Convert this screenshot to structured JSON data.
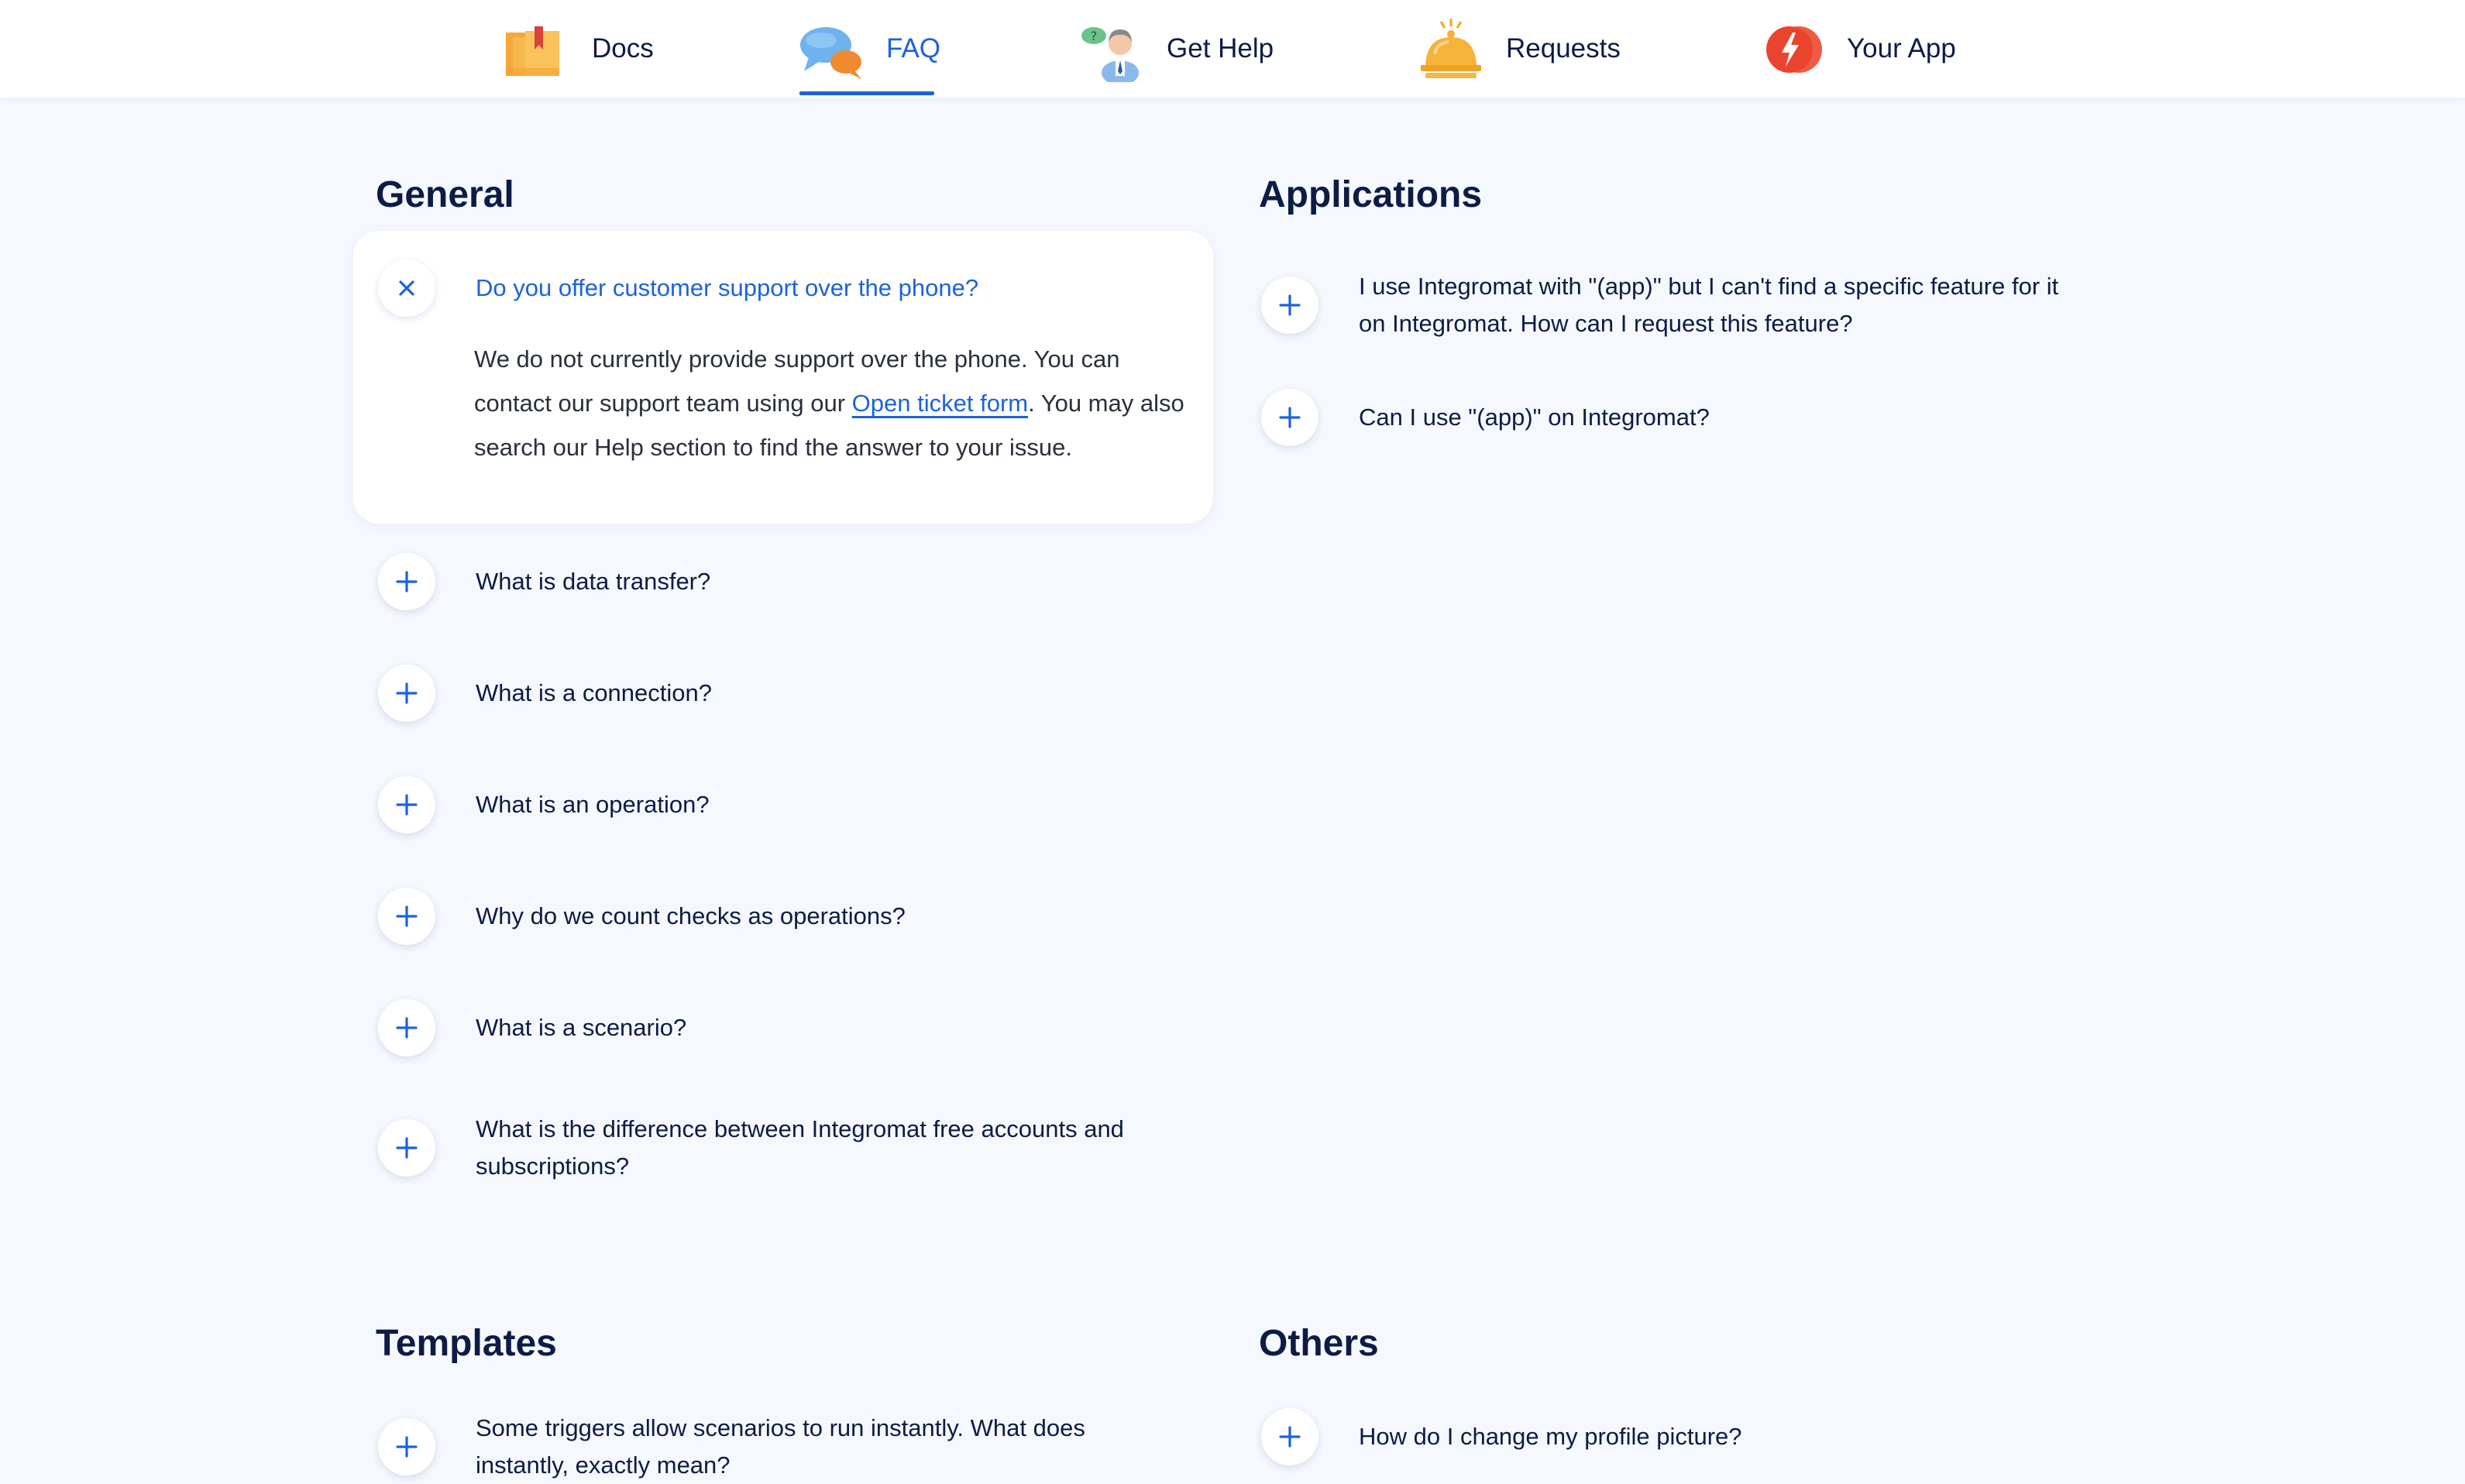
{
  "nav": {
    "items": [
      {
        "label": "Docs",
        "icon": "folder-docs-icon"
      },
      {
        "label": "FAQ",
        "icon": "chat-bubbles-icon",
        "active": true
      },
      {
        "label": "Get Help",
        "icon": "support-person-icon"
      },
      {
        "label": "Requests",
        "icon": "service-bell-icon"
      },
      {
        "label": "Your App",
        "icon": "lightning-app-icon"
      }
    ]
  },
  "general": {
    "title": "General",
    "expanded": {
      "question": "Do you offer customer support over the phone?",
      "answer_before": "We do not currently provide support over the phone. You can contact our support team using our ",
      "answer_link": "Open ticket form",
      "answer_after": ". You may also search our Help section to find the answer to your issue."
    },
    "items": [
      "What is data transfer?",
      "What is a connection?",
      "What is an operation?",
      "Why do we count checks as operations?",
      "What is a scenario?",
      "What is the difference between Integromat free accounts and subscriptions?"
    ]
  },
  "applications": {
    "title": "Applications",
    "items": [
      "I use Integromat with \"(app)\" but I can't find a specific feature for it on Integromat. How can I request this feature?",
      "Can I use \"(app)\" on Integromat?"
    ]
  },
  "templates": {
    "title": "Templates",
    "items": [
      "Some triggers allow scenarios to run instantly. What does instantly, exactly mean?"
    ]
  },
  "others": {
    "title": "Others",
    "items": [
      "How do I change my profile picture?"
    ]
  },
  "colors": {
    "accent": "#1c62de",
    "text": "#0c1c45",
    "page_bg": "#f5f8fd"
  }
}
